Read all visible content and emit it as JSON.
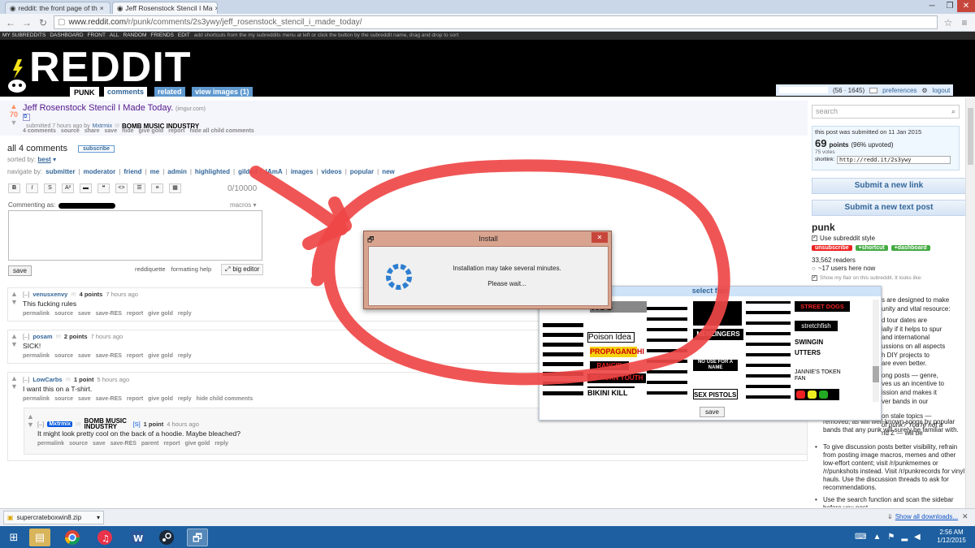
{
  "browser": {
    "tabs": [
      {
        "title": "reddit: the front page of th",
        "active": false
      },
      {
        "title": "Jeff Rosenstock Stencil I Ma",
        "active": true
      }
    ],
    "url_prefix": "www.reddit.com",
    "url_path": "/r/punk/comments/2s3ywy/jeff_rosenstock_stencil_i_made_today/",
    "minimize": "─",
    "maximize": "❐",
    "close": "✕"
  },
  "srbar": {
    "items": [
      "MY SUBREDDITS",
      "DASHBOARD",
      "FRONT",
      "ALL",
      "RANDOM",
      "FRIENDS",
      "EDIT"
    ],
    "hint": "add shortcuts from the my subreddits menu at left or click the button by the subreddit name, drag and drop to sort"
  },
  "header": {
    "logo": "REDDIT",
    "subreddit": "PUNK",
    "tabs": [
      "comments",
      "related",
      "view images (1)"
    ],
    "karma": "(56 · 1645)",
    "preferences": "preferences",
    "logout": "logout"
  },
  "post": {
    "score": "70",
    "title": "Jeff Rosenstock Stencil I Made Today.",
    "domain": "(imgur.com)",
    "submitted": "submitted 7 hours ago by",
    "author": "Mxtrmix",
    "flair": "BOMB MUSIC INDUSTRY",
    "links": [
      "4 comments",
      "source",
      "share",
      "save",
      "hide",
      "give gold",
      "report",
      "hide all child comments"
    ]
  },
  "comments_area": {
    "heading": "all 4 comments",
    "subscribe": "subscribe",
    "sorted_label": "sorted by:",
    "sorted_value": "best",
    "navigate_label": "navigate by:",
    "navigate": [
      "submitter",
      "moderator",
      "friend",
      "me",
      "admin",
      "highlighted",
      "gilded",
      "IAmA",
      "images",
      "videos",
      "popular",
      "new"
    ],
    "toolbar": [
      "B",
      "I",
      "S",
      "A²",
      "▬",
      "❝",
      "<>",
      "☰",
      "≡",
      "▦"
    ],
    "char_count": "0/10000",
    "commenting_as": "Commenting as:",
    "macros": "macros ▾",
    "save": "save",
    "reddiquette": "reddiquette",
    "formatting_help": "formatting help",
    "big_editor": "big editor"
  },
  "comments": [
    {
      "user": "venusxenvy",
      "points": "4 points",
      "age": "7 hours ago",
      "body": "This fucking rules",
      "links": [
        "permalink",
        "source",
        "save",
        "save-RES",
        "report",
        "give gold",
        "reply"
      ]
    },
    {
      "user": "posam",
      "points": "2 points",
      "age": "7 hours ago",
      "body": "SICK!",
      "links": [
        "permalink",
        "source",
        "save",
        "save-RES",
        "report",
        "give gold",
        "reply"
      ]
    },
    {
      "user": "LowCarbs",
      "points": "1 point",
      "age": "5 hours ago",
      "body": "I want this on a T-shirt.",
      "links": [
        "permalink",
        "source",
        "save",
        "save-RES",
        "report",
        "give gold",
        "reply",
        "hide child comments"
      ]
    },
    {
      "user": "Mxtrmix",
      "flair": "[S]",
      "points": "1 point",
      "age": "4 hours ago",
      "body": "It might look pretty cool on the back of a hoodie. Maybe bleached?",
      "links": [
        "permalink",
        "source",
        "save",
        "save-RES",
        "parent",
        "report",
        "give gold",
        "reply"
      ]
    }
  ],
  "sidebar": {
    "search_placeholder": "search",
    "submitted_on": "this post was submitted on 11 Jan 2015",
    "points": "69",
    "points_label": "points",
    "upvoted": "(96% upvoted)",
    "votes": "75 votes",
    "shortlink_label": "shortlink:",
    "shortlink": "http://redd.it/2s3ywy",
    "submit_link": "Submit a new link",
    "submit_text": "Submit a new text post",
    "subreddit": "punk",
    "use_style": "Use subreddit style",
    "unsubscribe": "unsubscribe",
    "shortcut": "+shortcut",
    "dashboard": "+dashboard",
    "readers": "33,562 readers",
    "here_now": "~17 users here now",
    "show_flair": "Show my flair on this subreddit. It looks like:",
    "rules_partial": [
      "s are designed to make",
      "unity and vital resource:",
      "d tour dates are",
      "ially if it helps to spur",
      "and international",
      "ussions on all aspects",
      "h DIY projects to",
      "are even better.",
      "ong posts — genre,",
      "ves us an incentive to",
      "ission and makes it",
      "ver bands in our",
      "on stale topics —",
      "of punk? You're not a",
      "nd Z — will be"
    ],
    "rules_full_a": "removed, as will well-known songs by popular bands that any punk will surely be familiar with.",
    "rule_b": "To give discussion posts better visibility, refrain from posting image macros, memes and other low-effort content; visit /r/punkmemes or /r/punkshots instead. Visit /r/punkrecords for vinyl hauls. Use the discussion threads to ask for recommendations.",
    "rule_c": "Use the search function and scan the sidebar before you post."
  },
  "flair_picker": {
    "title": "select flair",
    "visible_labels": [
      "ROS",
      "Poison Idea",
      "PROPAGANDHI",
      "RANCID",
      "REAGAN YOUTH",
      "BIKINI KILL",
      "MENZINGERS",
      "NO USE FOR A NAME",
      "SEX PISTOLS",
      "STREET DOGS",
      "stretchfish",
      "SWINGIN UTTERS",
      "JANNIE'S TOKEN FAN"
    ],
    "save": "save"
  },
  "install_dialog": {
    "title": "Install",
    "message": "Installation may take several minutes.",
    "wait": "Please wait...",
    "close": "✕"
  },
  "downloads": {
    "file": "supercrateboxwin8.zip",
    "show_all": "Show all downloads...",
    "close": "✕"
  },
  "taskbar": {
    "time": "2:56 AM",
    "date": "1/12/2015"
  },
  "colors": {
    "reddit_header": "#000000",
    "annotation_red": "#ef4646",
    "taskbar": "#1d5fa0",
    "dialog_title": "#d9a48f"
  }
}
